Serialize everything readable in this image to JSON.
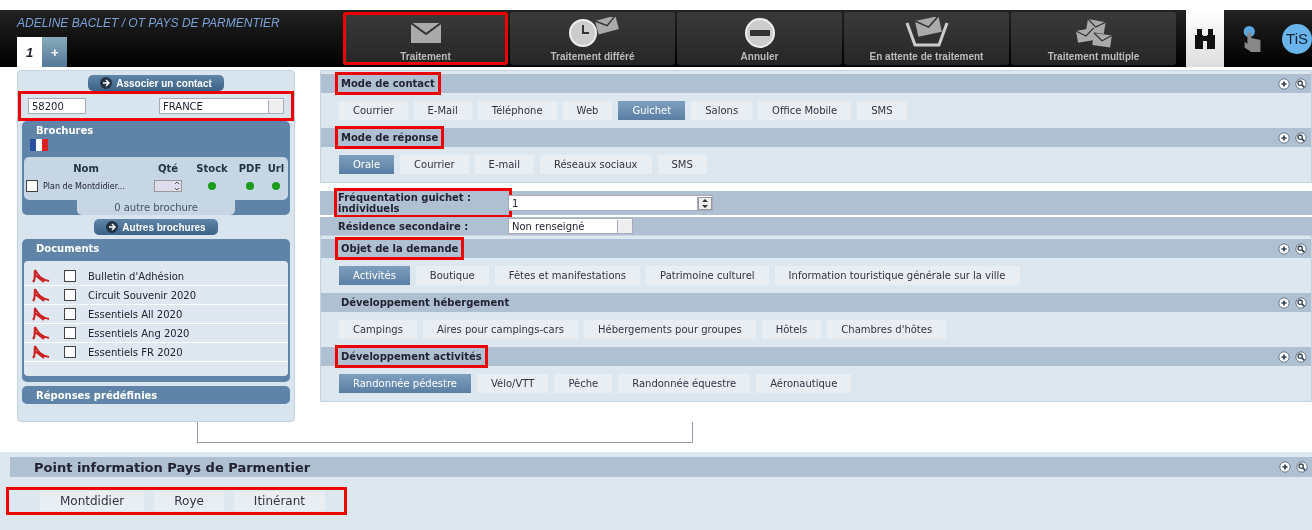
{
  "header": {
    "user": "ADELINE BACLET / OT PAYS DE PARMENTIER",
    "tabs": [
      {
        "label": "1",
        "selected": true
      },
      {
        "label": "+",
        "selected": false
      }
    ]
  },
  "toolbar": [
    {
      "label": "Traitement",
      "kind": "mail",
      "highlighted": true
    },
    {
      "label": "Traitement différé",
      "kind": "clock",
      "highlighted": false
    },
    {
      "label": "Annuler",
      "kind": "cancel",
      "highlighted": false
    },
    {
      "label": "En attente de traitement",
      "kind": "waiting",
      "highlighted": false
    },
    {
      "label": "Traitement multiple",
      "kind": "multiple",
      "highlighted": false
    }
  ],
  "tools": [
    {
      "kind": "binoculars",
      "selected": true
    },
    {
      "kind": "hand",
      "selected": false
    },
    {
      "kind": "bubble",
      "label": "TiS"
    }
  ],
  "sidebar": {
    "associate_button": "Associer un contact",
    "postcode": "58200",
    "country": "FRANCE",
    "contact_highlighted": true,
    "brochures": {
      "title": "Brochures",
      "columns": [
        "Nom",
        "Qté",
        "Stock",
        "PDF",
        "Url"
      ],
      "rows": [
        {
          "name": "Plan de Montdidier...",
          "checked": false,
          "stock": true,
          "pdf": true,
          "url": true
        }
      ],
      "footer": "0 autre brochure"
    },
    "other_button": "Autres brochures",
    "documents": {
      "title": "Documents",
      "items": [
        {
          "name": "Bulletin d'Adhésion",
          "checked": false
        },
        {
          "name": "Circuit Souvenir 2020",
          "checked": false
        },
        {
          "name": "Essentiels All 2020",
          "checked": false
        },
        {
          "name": "Essentiels Ang 2020",
          "checked": false
        },
        {
          "name": "Essentiels FR 2020",
          "checked": false
        }
      ]
    },
    "predefined_title": "Réponses prédéfinies"
  },
  "sections": [
    {
      "kind": "options",
      "title": "Mode de contact",
      "highlighted": true,
      "options": [
        {
          "label": "Courrier",
          "selected": false
        },
        {
          "label": "E-Mail",
          "selected": false
        },
        {
          "label": "Téléphone",
          "selected": false
        },
        {
          "label": "Web",
          "selected": false
        },
        {
          "label": "Guichet",
          "selected": true
        },
        {
          "label": "Salons",
          "selected": false
        },
        {
          "label": "Office Mobile",
          "selected": false
        },
        {
          "label": "SMS",
          "selected": false
        }
      ]
    },
    {
      "kind": "options",
      "title": "Mode de réponse",
      "highlighted": true,
      "options": [
        {
          "label": "Orale",
          "selected": true
        },
        {
          "label": "Courrier",
          "selected": false
        },
        {
          "label": "E-mail",
          "selected": false
        },
        {
          "label": "Réseaux sociaux",
          "selected": false
        },
        {
          "label": "SMS",
          "selected": false
        }
      ]
    },
    {
      "kind": "fields",
      "fields": [
        {
          "kind": "spinner",
          "label": "Fréquentation guichet : individuels",
          "value": "1",
          "highlighted": true
        },
        {
          "kind": "select",
          "label": "Résidence secondaire :",
          "value": "Non renseigné"
        }
      ]
    },
    {
      "kind": "options",
      "title": "Objet de la demande",
      "highlighted": true,
      "options": [
        {
          "label": "Activités",
          "selected": true
        },
        {
          "label": "Boutique",
          "selected": false
        },
        {
          "label": "Fêtes et manifestations",
          "selected": false
        },
        {
          "label": "Patrimoine culturel",
          "selected": false
        },
        {
          "label": "Information touristique générale sur la ville",
          "selected": false
        }
      ]
    },
    {
      "kind": "options",
      "title": "Développement hébergement",
      "options": [
        {
          "label": "Campings",
          "selected": false
        },
        {
          "label": "Aires pour campings-cars",
          "selected": false
        },
        {
          "label": "Hébergements pour groupes",
          "selected": false
        },
        {
          "label": "Hôtels",
          "selected": false
        },
        {
          "label": "Chambres d'hôtes",
          "selected": false
        }
      ]
    },
    {
      "kind": "options",
      "title": "Développement activités",
      "highlighted": true,
      "options": [
        {
          "label": "Randonnée pédestre",
          "selected": true
        },
        {
          "label": "Vélo/VTT",
          "selected": false
        },
        {
          "label": "Pêche",
          "selected": false
        },
        {
          "label": "Randonnée équestre",
          "selected": false
        },
        {
          "label": "Aéronautique",
          "selected": false
        }
      ]
    }
  ],
  "point_info": {
    "title": "Point information Pays de Parmentier",
    "highlighted": true,
    "options": [
      {
        "label": "Montdidier",
        "selected": false
      },
      {
        "label": "Roye",
        "selected": false
      },
      {
        "label": "Itinérant",
        "selected": false
      }
    ]
  }
}
